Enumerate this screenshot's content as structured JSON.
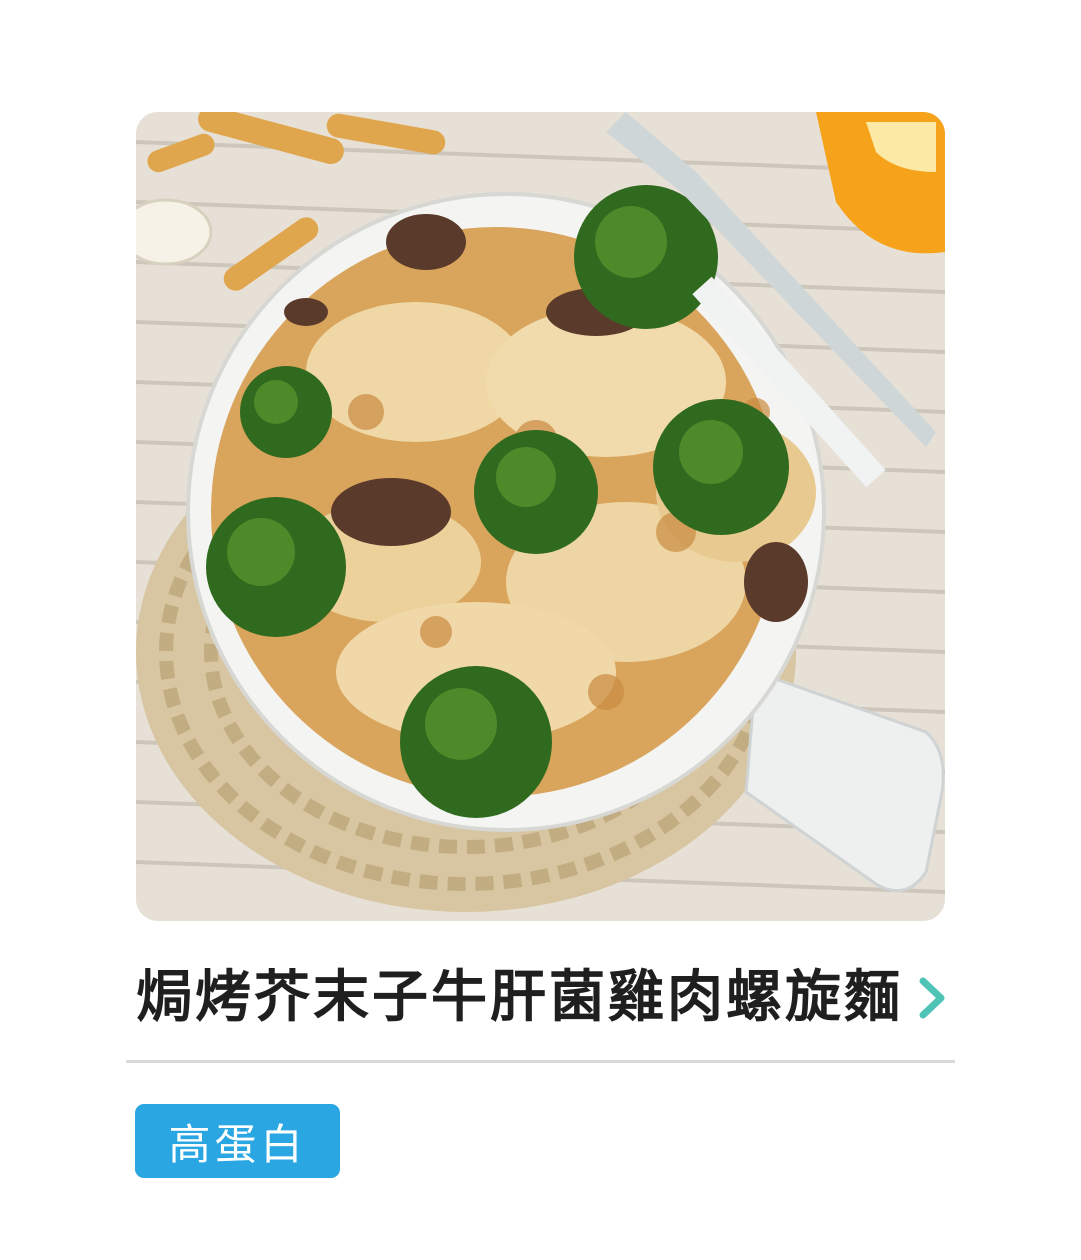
{
  "recipe": {
    "title": "焗烤芥末子牛肝菌雞肉螺旋麵",
    "chevron_icon": "chevron-right-icon",
    "chevron_color": "#4fc3b5",
    "image_alt": "baked pasta dish photo"
  },
  "tags": [
    {
      "label": "高蛋白",
      "color": "#2aa7e2"
    }
  ]
}
